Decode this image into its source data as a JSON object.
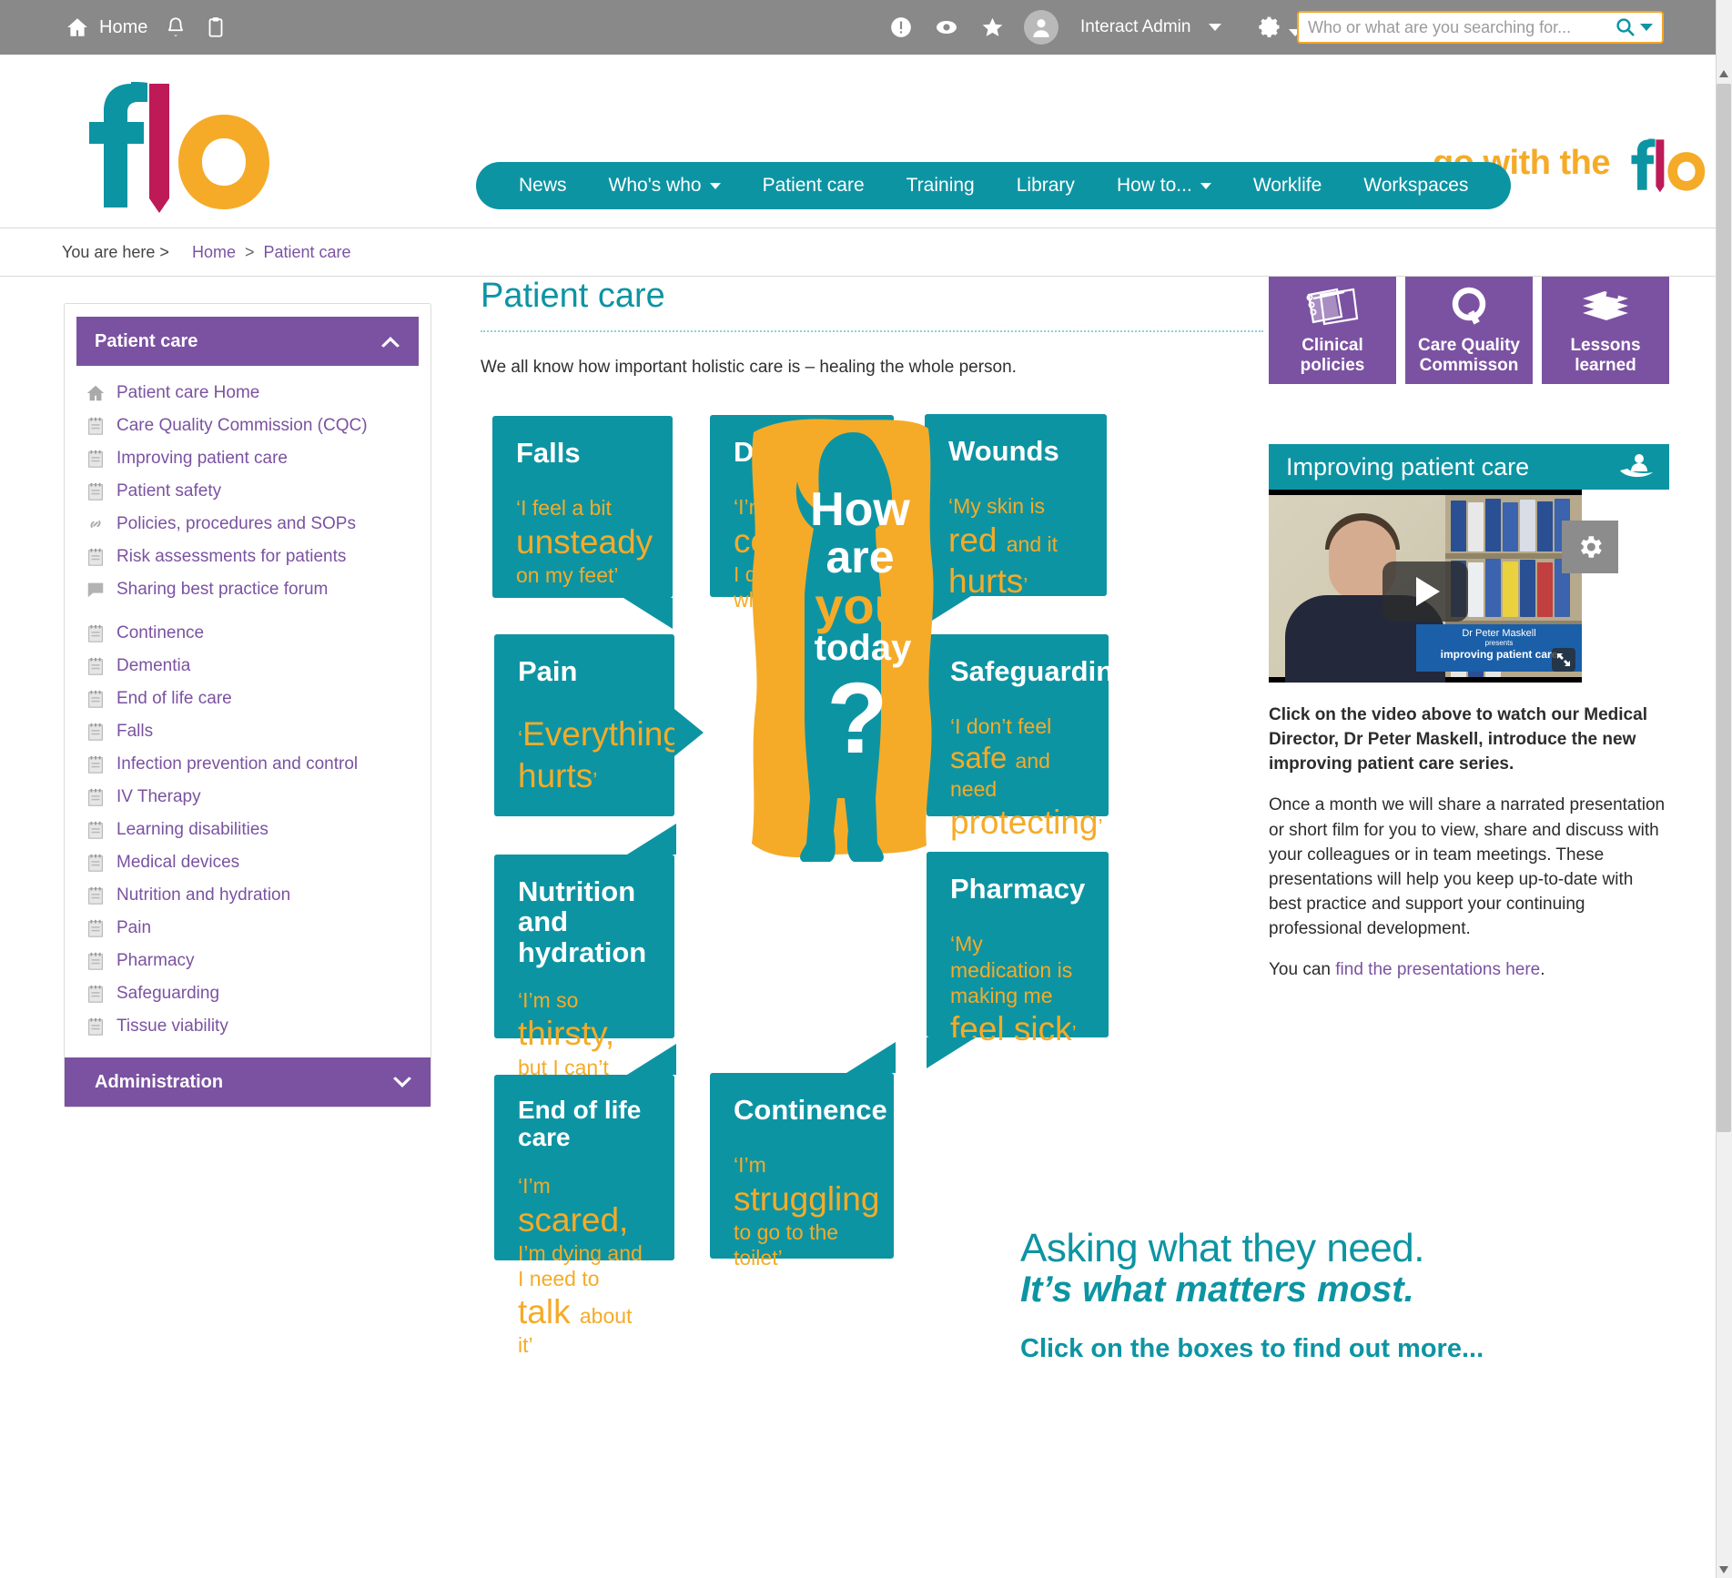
{
  "topbar": {
    "home_label": "Home",
    "home_icon": "home-icon",
    "bell_icon": "bell-icon",
    "clipboard_icon": "clipboard-icon",
    "alert_icon": "exclamation-circle-icon",
    "eye_icon": "eye-icon",
    "star_icon": "star-icon",
    "avatar_icon": "user-avatar-icon",
    "user_name": "Interact Admin",
    "user_caret_icon": "chevron-down-icon",
    "settings_icon": "gear-icon",
    "search_placeholder": "Who or what are you searching for...",
    "search_value": "",
    "search_icon": "search-icon",
    "search_caret_icon": "chevron-down-icon",
    "bg_color": "#898989"
  },
  "brand": {
    "logo_text": "flo",
    "logo_colors": {
      "f": "#0d94a3",
      "l": "#bd1a57",
      "o": "#f5ab28"
    },
    "tagline": "...go with the",
    "tagline_logo": "flo"
  },
  "nav": {
    "color": "#0d94a3",
    "items": [
      {
        "label": "News",
        "has_caret": false
      },
      {
        "label": "Who's who",
        "has_caret": true
      },
      {
        "label": "Patient care",
        "has_caret": false
      },
      {
        "label": "Training",
        "has_caret": false
      },
      {
        "label": "Library",
        "has_caret": false
      },
      {
        "label": "How to...",
        "has_caret": true
      },
      {
        "label": "Worklife",
        "has_caret": false
      },
      {
        "label": "Workspaces",
        "has_caret": false
      }
    ]
  },
  "breadcrumb": {
    "prefix": "You are here >",
    "home": "Home",
    "sep": ">",
    "current": "Patient care"
  },
  "sidebar": {
    "header": "Patient care",
    "header_chevron": "chevron-up-icon",
    "footer": "Administration",
    "footer_chevron": "chevron-down-icon",
    "accent": "#7b52a1",
    "group1": [
      {
        "label": "Patient care Home",
        "icon": "home-icon"
      },
      {
        "label": "Care Quality Commission (CQC)",
        "icon": "page-icon"
      },
      {
        "label": "Improving patient care",
        "icon": "page-icon"
      },
      {
        "label": "Patient safety",
        "icon": "page-icon"
      },
      {
        "label": "Policies, procedures and SOPs",
        "icon": "link-icon"
      },
      {
        "label": "Risk assessments for patients",
        "icon": "page-icon"
      },
      {
        "label": "Sharing best practice forum",
        "icon": "forum-icon"
      }
    ],
    "group2": [
      {
        "label": "Continence",
        "icon": "page-icon"
      },
      {
        "label": "Dementia",
        "icon": "page-icon"
      },
      {
        "label": "End of life care",
        "icon": "page-icon"
      },
      {
        "label": "Falls",
        "icon": "page-icon"
      },
      {
        "label": "Infection prevention and control",
        "icon": "page-icon"
      },
      {
        "label": "IV Therapy",
        "icon": "page-icon"
      },
      {
        "label": "Learning disabilities",
        "icon": "page-icon"
      },
      {
        "label": "Medical devices",
        "icon": "page-icon"
      },
      {
        "label": "Nutrition and hydration",
        "icon": "page-icon"
      },
      {
        "label": "Pain",
        "icon": "page-icon"
      },
      {
        "label": "Pharmacy",
        "icon": "page-icon"
      },
      {
        "label": "Safeguarding",
        "icon": "page-icon"
      },
      {
        "label": "Tissue viability",
        "icon": "page-icon"
      }
    ]
  },
  "main": {
    "title": "Patient care",
    "intro": "We all know how important holistic care is – healing the whole person.",
    "bubbles": [
      {
        "title": "Falls",
        "quote_parts": [
          {
            "t": "‘I feel a bit ",
            "s": "sm"
          },
          {
            "t": "unsteady ",
            "s": "xbig"
          },
          {
            "t": "on my feet’",
            "s": "sm"
          }
        ]
      },
      {
        "title": "Dementia",
        "quote_parts": [
          {
            "t": "‘I’m ",
            "s": "sm"
          },
          {
            "t": "confused. ",
            "s": "xbig"
          },
          {
            "t": "I don’t know where I am’",
            "s": "sm"
          }
        ]
      },
      {
        "title": "Wounds",
        "quote_parts": [
          {
            "t": "‘My skin is ",
            "s": "sm"
          },
          {
            "t": "red ",
            "s": "xbig"
          },
          {
            "t": "and it ",
            "s": "sm"
          },
          {
            "t": "hurts",
            "s": "xbig"
          },
          {
            "t": "’",
            "s": "sm"
          }
        ]
      },
      {
        "title": "Pain",
        "quote_parts": [
          {
            "t": "‘",
            "s": "sm"
          },
          {
            "t": "Everything hurts",
            "s": "xbig"
          },
          {
            "t": "’",
            "s": "sm"
          }
        ]
      },
      {
        "title": "Safeguarding",
        "quote_parts": [
          {
            "t": "‘I don’t feel ",
            "s": "sm"
          },
          {
            "t": "safe ",
            "s": "big"
          },
          {
            "t": "and need ",
            "s": "sm"
          },
          {
            "t": "protecting",
            "s": "xbig"
          },
          {
            "t": "’",
            "s": "sm"
          }
        ]
      },
      {
        "title": "Nutrition and hydration",
        "quote_parts": [
          {
            "t": "‘I’m so ",
            "s": "sm"
          },
          {
            "t": "thirsty, ",
            "s": "xbig"
          },
          {
            "t": "but I can’t reach my water’",
            "s": "sm"
          }
        ]
      },
      {
        "title": "Pharmacy",
        "quote_parts": [
          {
            "t": "‘My medication is making me ",
            "s": "sm"
          },
          {
            "t": "feel sick",
            "s": "xbig"
          },
          {
            "t": "’",
            "s": "sm"
          }
        ]
      },
      {
        "title": "End of life care",
        "quote_parts": [
          {
            "t": "‘I’m ",
            "s": "sm"
          },
          {
            "t": "scared, ",
            "s": "xbig"
          },
          {
            "t": "I’m dying and I need to ",
            "s": "sm"
          },
          {
            "t": "talk ",
            "s": "xbig"
          },
          {
            "t": "about it’",
            "s": "sm"
          }
        ]
      },
      {
        "title": "Continence",
        "quote_parts": [
          {
            "t": "‘I’m ",
            "s": "sm"
          },
          {
            "t": "struggling ",
            "s": "xbig"
          },
          {
            "t": "to go to the toilet’",
            "s": "sm"
          }
        ]
      }
    ],
    "center_graphic": {
      "line1": "How",
      "line2": "are",
      "line3": "you",
      "line4": "today",
      "line5": "?"
    },
    "slogan": {
      "line1": "Asking what they need.",
      "line2": "It’s what matters most.",
      "line3": "Click on the boxes to find out more..."
    },
    "bubble_color": "#0d94a3",
    "quote_color": "#f5ab28"
  },
  "right": {
    "tiles": [
      {
        "label_1": "Clinical",
        "label_2": "policies",
        "icon": "notebooks-icon"
      },
      {
        "label_1": "Care Quality",
        "label_2": "Commisson",
        "icon": "cqc-q-icon"
      },
      {
        "label_1": "Lessons",
        "label_2": "learned",
        "icon": "books-stack-icon"
      }
    ],
    "video_header": "Improving patient care",
    "video_header_icon": "patient-in-hand-icon",
    "video_play_icon": "play-icon",
    "video_fullscreen_icon": "fullscreen-icon",
    "video_overlay": {
      "name": "Dr Peter Maskell",
      "presents": "presents",
      "title": "improving patient care"
    },
    "gear_icon": "gear-icon",
    "para1": "Click on the video above to watch our Medical Director, Dr Peter Maskell, introduce the new improving patient care series.",
    "para2": "Once a month we will share a narrated presentation or short film for you to view, share and discuss with your colleagues or in team meetings. These presentations will help you keep up-to-date with best practice and support your continuing professional development.",
    "para3_prefix": "You can ",
    "para3_link": "find the presentations here",
    "para3_suffix": "."
  },
  "scrollbar": {
    "up_icon": "caret-up-icon",
    "down_icon": "caret-down-icon"
  }
}
